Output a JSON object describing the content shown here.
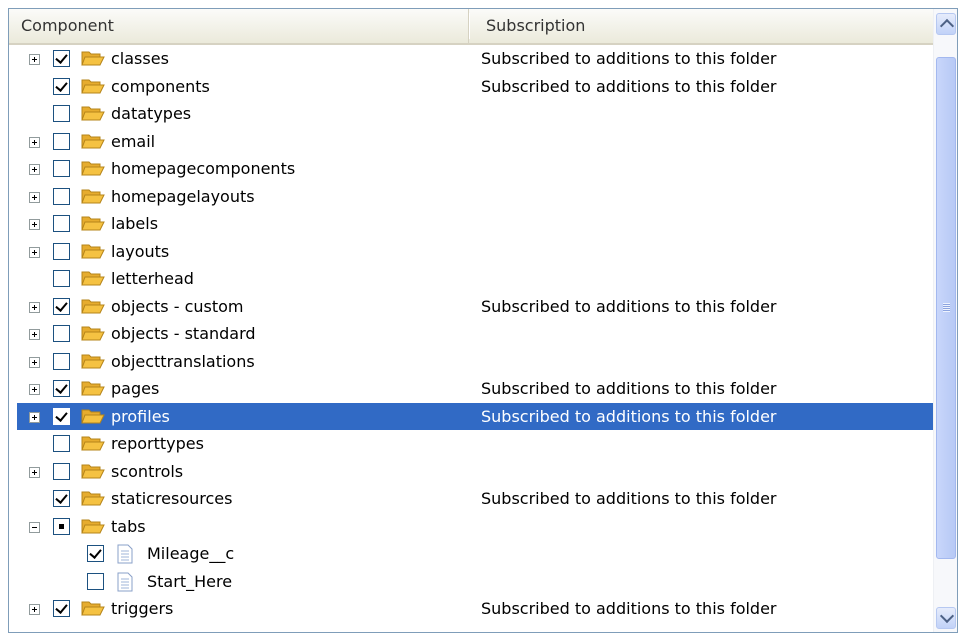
{
  "header": {
    "component_label": "Component",
    "subscription_label": "Subscription"
  },
  "rows": [
    {
      "label": "classes",
      "level": 0,
      "expander": "plus",
      "check": "checked",
      "icon": "folder",
      "subscription": "Subscribed to additions to this folder",
      "selected": false
    },
    {
      "label": "components",
      "level": 0,
      "expander": "none",
      "check": "checked",
      "icon": "folder",
      "subscription": "Subscribed to additions to this folder",
      "selected": false
    },
    {
      "label": "datatypes",
      "level": 0,
      "expander": "none",
      "check": "unchecked",
      "icon": "folder",
      "subscription": "",
      "selected": false
    },
    {
      "label": "email",
      "level": 0,
      "expander": "plus",
      "check": "unchecked",
      "icon": "folder",
      "subscription": "",
      "selected": false
    },
    {
      "label": "homepagecomponents",
      "level": 0,
      "expander": "plus",
      "check": "unchecked",
      "icon": "folder",
      "subscription": "",
      "selected": false
    },
    {
      "label": "homepagelayouts",
      "level": 0,
      "expander": "plus",
      "check": "unchecked",
      "icon": "folder",
      "subscription": "",
      "selected": false
    },
    {
      "label": "labels",
      "level": 0,
      "expander": "plus",
      "check": "unchecked",
      "icon": "folder",
      "subscription": "",
      "selected": false
    },
    {
      "label": "layouts",
      "level": 0,
      "expander": "plus",
      "check": "unchecked",
      "icon": "folder",
      "subscription": "",
      "selected": false
    },
    {
      "label": "letterhead",
      "level": 0,
      "expander": "none",
      "check": "unchecked",
      "icon": "folder",
      "subscription": "",
      "selected": false
    },
    {
      "label": "objects - custom",
      "level": 0,
      "expander": "plus",
      "check": "checked",
      "icon": "folder",
      "subscription": "Subscribed to additions to this folder",
      "selected": false
    },
    {
      "label": "objects - standard",
      "level": 0,
      "expander": "plus",
      "check": "unchecked",
      "icon": "folder",
      "subscription": "",
      "selected": false
    },
    {
      "label": "objecttranslations",
      "level": 0,
      "expander": "plus",
      "check": "unchecked",
      "icon": "folder",
      "subscription": "",
      "selected": false
    },
    {
      "label": "pages",
      "level": 0,
      "expander": "plus",
      "check": "checked",
      "icon": "folder",
      "subscription": "Subscribed to additions to this folder",
      "selected": false
    },
    {
      "label": "profiles",
      "level": 0,
      "expander": "plus",
      "check": "checked",
      "icon": "folder",
      "subscription": "Subscribed to additions to this folder",
      "selected": true
    },
    {
      "label": "reporttypes",
      "level": 0,
      "expander": "none",
      "check": "unchecked",
      "icon": "folder",
      "subscription": "",
      "selected": false
    },
    {
      "label": "scontrols",
      "level": 0,
      "expander": "plus",
      "check": "unchecked",
      "icon": "folder",
      "subscription": "",
      "selected": false
    },
    {
      "label": "staticresources",
      "level": 0,
      "expander": "none",
      "check": "checked",
      "icon": "folder",
      "subscription": "Subscribed to additions to this folder",
      "selected": false
    },
    {
      "label": "tabs",
      "level": 0,
      "expander": "minus",
      "check": "partial",
      "icon": "folder",
      "subscription": "",
      "selected": false
    },
    {
      "label": "Mileage__c",
      "level": 1,
      "expander": "none",
      "check": "checked",
      "icon": "document",
      "subscription": "",
      "selected": false
    },
    {
      "label": "Start_Here",
      "level": 1,
      "expander": "none",
      "check": "unchecked",
      "icon": "document",
      "subscription": "",
      "selected": false
    },
    {
      "label": "triggers",
      "level": 0,
      "expander": "plus",
      "check": "checked",
      "icon": "folder",
      "subscription": "Subscribed to additions to this folder",
      "selected": false
    }
  ],
  "colors": {
    "selection": "#316ac5",
    "folder": "#f5c242",
    "header_bg": "#ebeadb",
    "scrollbar_thumb": "#c1d2f8"
  }
}
